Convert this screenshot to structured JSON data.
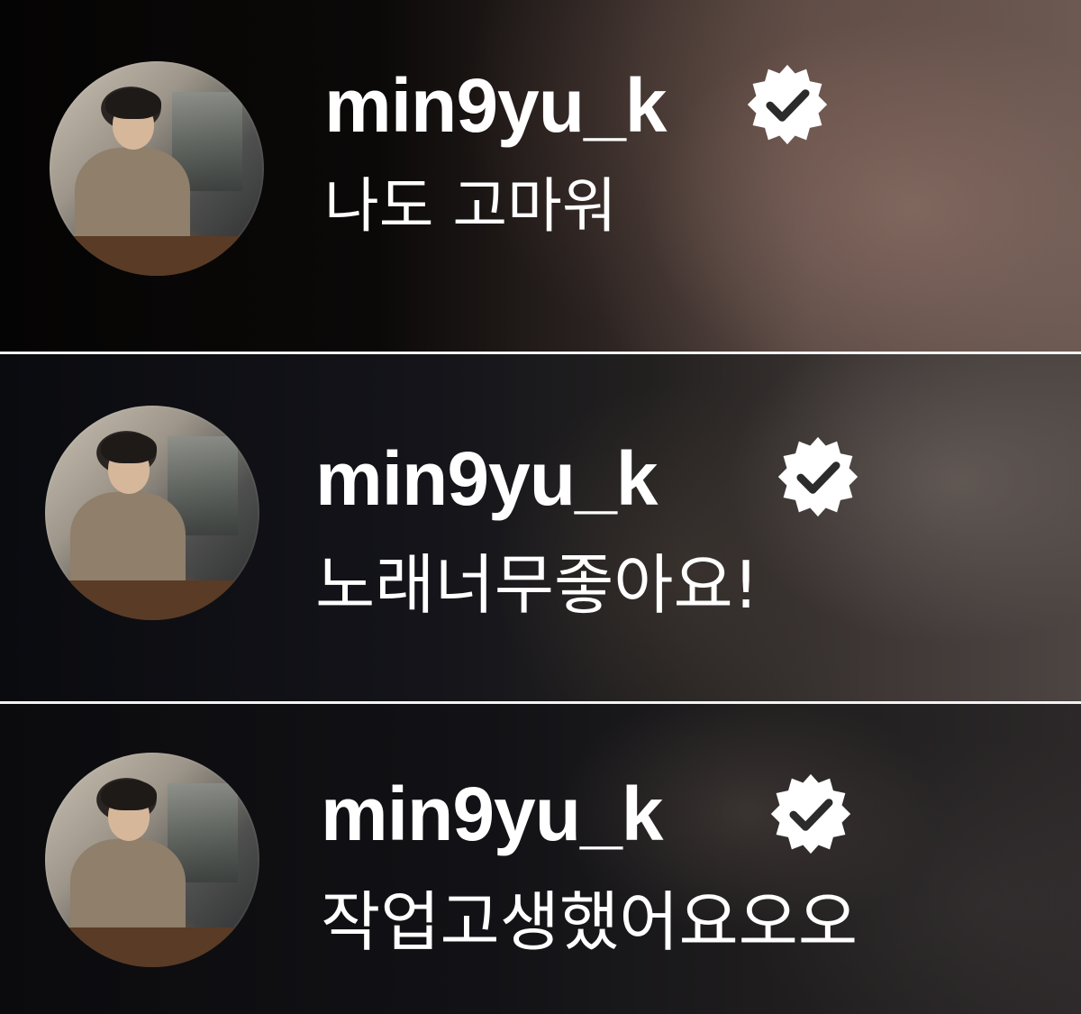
{
  "comments": [
    {
      "username": "min9yu_k",
      "verified": true,
      "text": "나도 고마워",
      "avatar_icon": "profile-photo"
    },
    {
      "username": "min9yu_k",
      "verified": true,
      "text": "노래너무좋아요!",
      "avatar_icon": "profile-photo"
    },
    {
      "username": "min9yu_k",
      "verified": true,
      "text": "작업고생했어요오오",
      "avatar_icon": "profile-photo"
    }
  ],
  "colors": {
    "text": "#ffffff",
    "badge_fill": "#ffffff",
    "badge_check": "#2b2b2b",
    "divider": "#f2f2f2"
  }
}
